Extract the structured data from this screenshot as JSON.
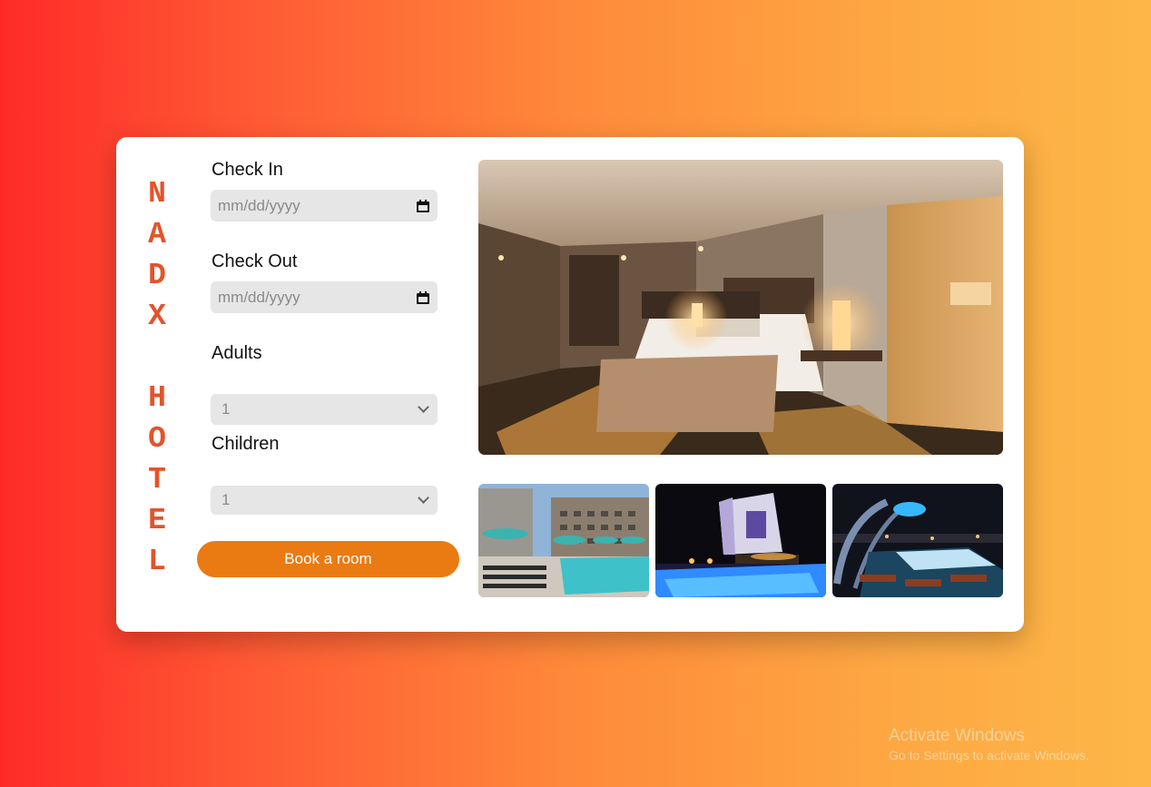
{
  "brand": {
    "letters": [
      "N",
      "A",
      "D",
      "X",
      "",
      "H",
      "O",
      "T",
      "E",
      "L"
    ]
  },
  "form": {
    "check_in_label": "Check In",
    "check_in_placeholder": "mm/dd/yyyy",
    "check_out_label": "Check Out",
    "check_out_placeholder": "mm/dd/yyyy",
    "adults_label": "Adults",
    "adults_value": "1",
    "children_label": "Children",
    "children_value": "1",
    "book_label": "Book a room"
  },
  "gallery": {
    "hero": "hotel bedroom",
    "thumbs": [
      "rooftop pool",
      "hotel exterior at night",
      "rooftop lounge at night"
    ]
  },
  "watermark": {
    "line1": "Activate Windows",
    "line2": "Go to Settings to activate Windows."
  },
  "colors": {
    "brand": "#e4532b",
    "button": "#ea7a12",
    "field": "#e6e6e6"
  }
}
